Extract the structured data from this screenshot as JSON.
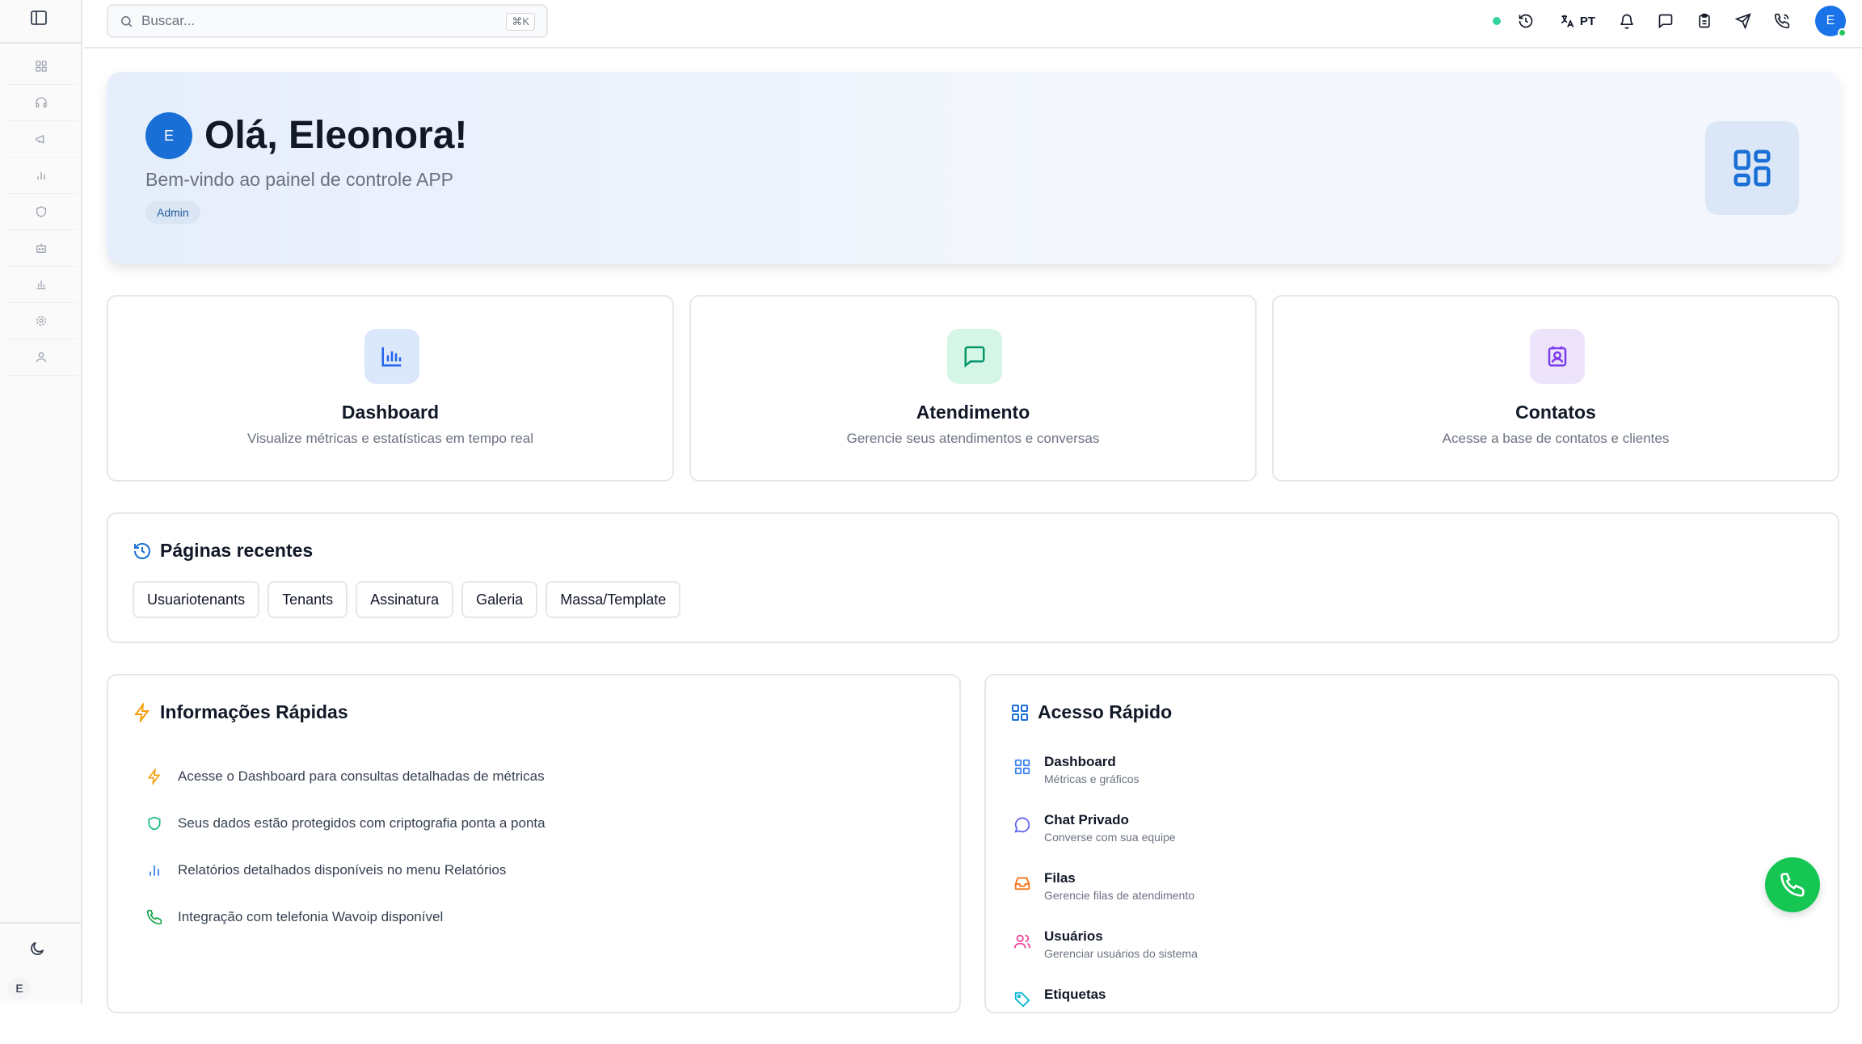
{
  "sidebar": {
    "toggle_icon": "panel-left-icon",
    "items": [
      {
        "icon": "grid-icon"
      },
      {
        "icon": "headphones-icon"
      },
      {
        "icon": "megaphone-icon"
      },
      {
        "icon": "bar-chart-icon"
      },
      {
        "icon": "shield-icon"
      },
      {
        "icon": "bot-icon"
      },
      {
        "icon": "bar-chart-icon"
      },
      {
        "icon": "gear-icon"
      },
      {
        "icon": "user-icon"
      }
    ],
    "theme_icon": "moon-icon",
    "user_initial": "E"
  },
  "header": {
    "search": {
      "placeholder": "Buscar...",
      "shortcut": "⌘K"
    },
    "status_color": "#34d399",
    "language": "PT",
    "avatar_initial": "E"
  },
  "hero": {
    "avatar_initial": "E",
    "title": "Olá, Eleonora!",
    "subtitle": "Bem-vindo ao painel de controle APP",
    "badge": "Admin",
    "icon": "layout-grid-icon"
  },
  "features": [
    {
      "title": "Dashboard",
      "description": "Visualize métricas e estatísticas em tempo real",
      "icon": "bar-chart-icon",
      "color": "#2563eb",
      "bg": "#dbe7fb"
    },
    {
      "title": "Atendimento",
      "description": "Gerencie seus atendimentos e conversas",
      "icon": "message-square-icon",
      "color": "#059669",
      "bg": "#d5f5e6"
    },
    {
      "title": "Contatos",
      "description": "Acesse a base de contatos e clientes",
      "icon": "contact-icon",
      "color": "#7c3aed",
      "bg": "#ede4fb"
    }
  ],
  "recent": {
    "title": "Páginas recentes",
    "pages": [
      "Usuariotenants",
      "Tenants",
      "Assinatura",
      "Galeria",
      "Massa/Template"
    ]
  },
  "info": {
    "title": "Informações Rápidas",
    "items": [
      {
        "text": "Acesse o Dashboard para consultas detalhadas de métricas",
        "icon": "zap-icon",
        "color": "#f59e0b"
      },
      {
        "text": "Seus dados estão protegidos com criptografia ponta a ponta",
        "icon": "shield-icon",
        "color": "#10b981"
      },
      {
        "text": "Relatórios detalhados disponíveis no menu Relatórios",
        "icon": "bar-chart-icon",
        "color": "#3b82f6"
      },
      {
        "text": "Integração com telefonia Wavoip disponível",
        "icon": "phone-icon",
        "color": "#16a34a"
      }
    ]
  },
  "access": {
    "title": "Acesso Rápido",
    "items": [
      {
        "title": "Dashboard",
        "description": "Métricas e gráficos",
        "icon": "grid-icon",
        "color": "#3b82f6"
      },
      {
        "title": "Chat Privado",
        "description": "Converse com sua equipe",
        "icon": "message-circle-icon",
        "color": "#6366f1"
      },
      {
        "title": "Filas",
        "description": "Gerencie filas de atendimento",
        "icon": "inbox-icon",
        "color": "#f97316"
      },
      {
        "title": "Usuários",
        "description": "Gerenciar usuários do sistema",
        "icon": "users-icon",
        "color": "#ec4899"
      },
      {
        "title": "Etiquetas",
        "description": "",
        "icon": "tag-icon",
        "color": "#06b6d4"
      }
    ]
  },
  "fab": {
    "icon": "phone-icon",
    "color": "#16c653"
  }
}
